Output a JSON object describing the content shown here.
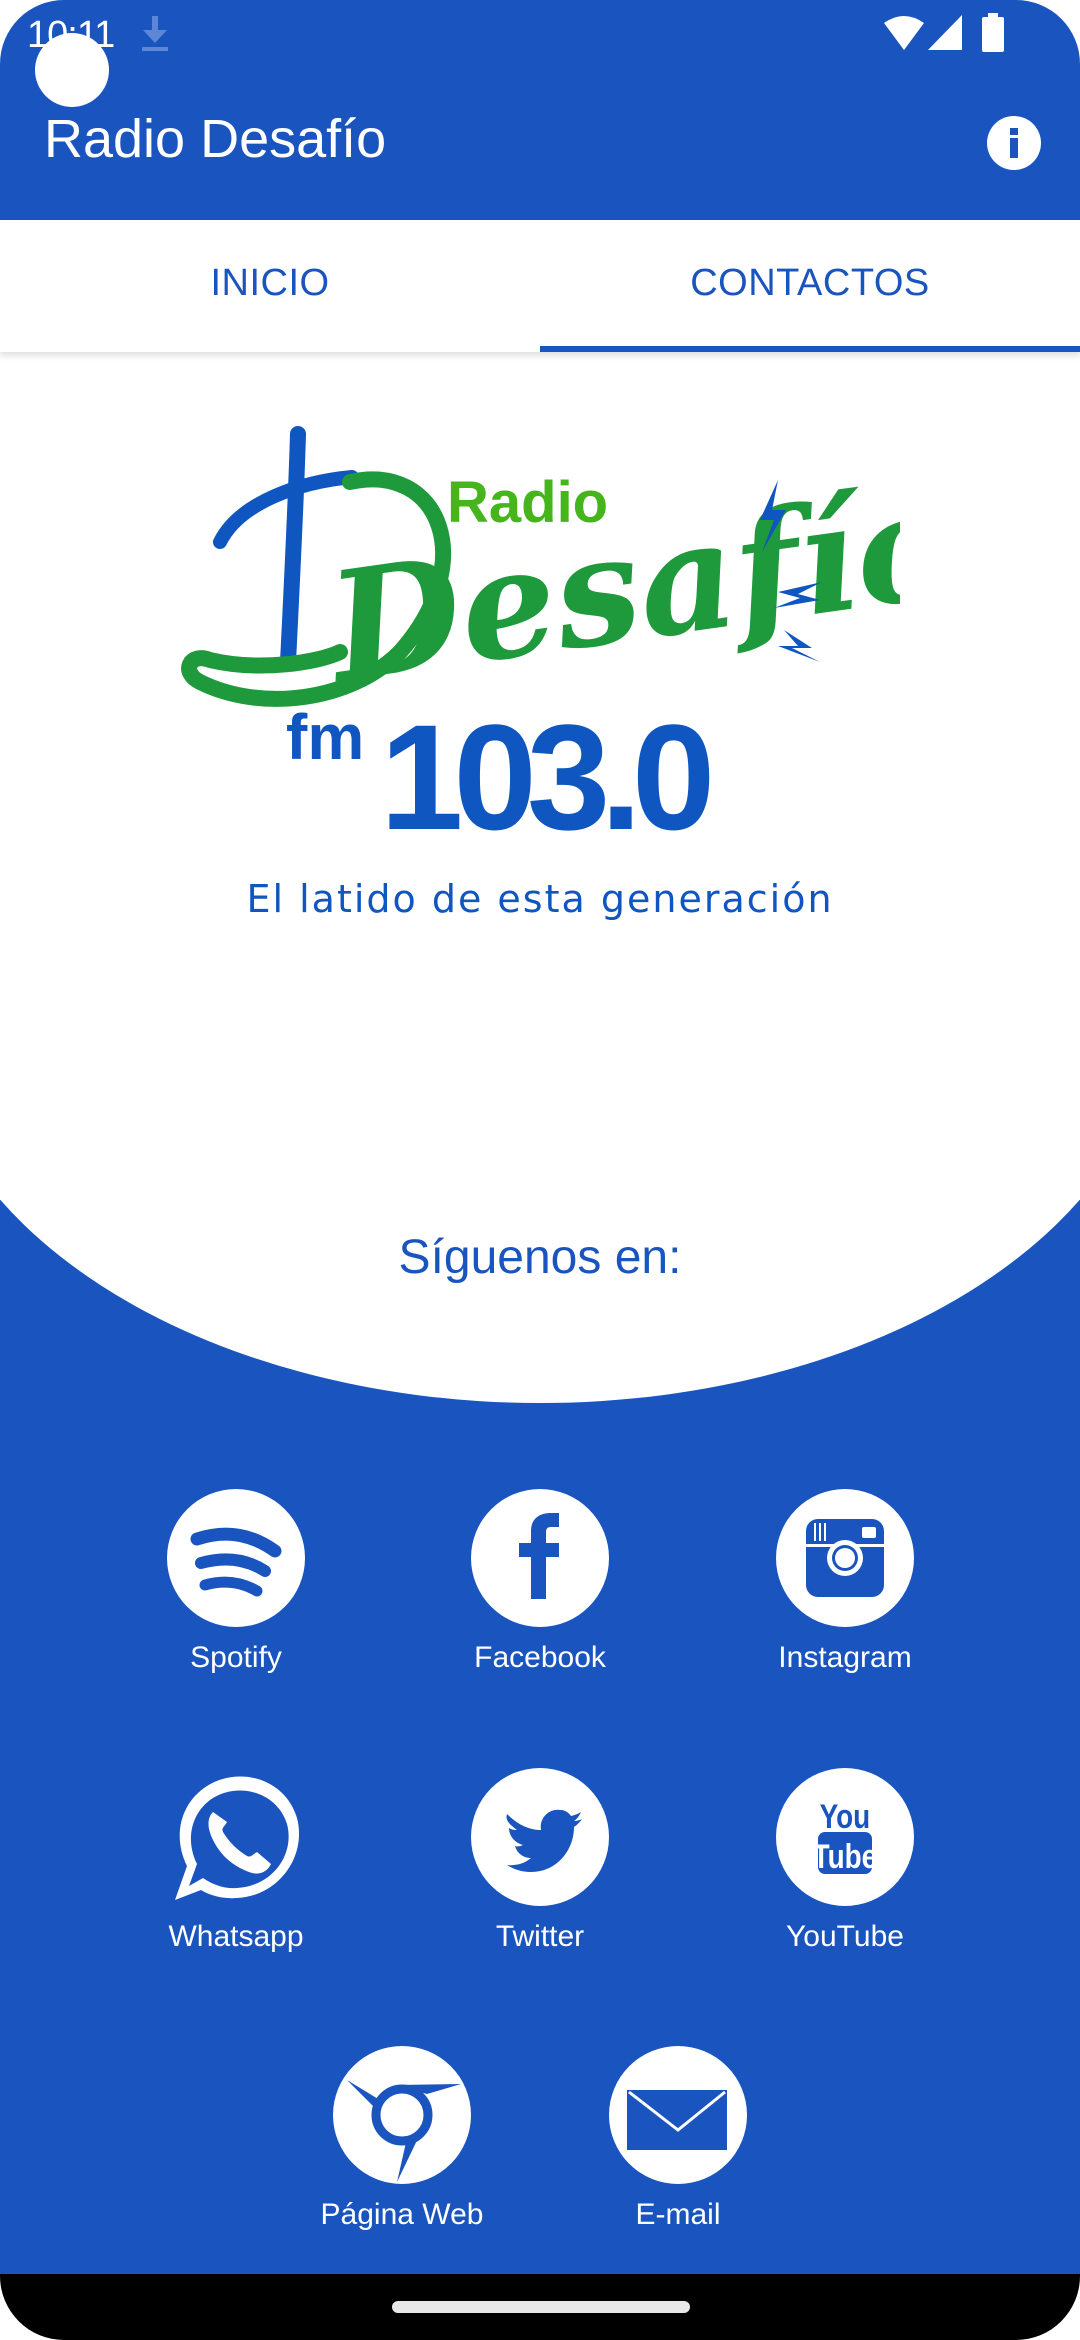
{
  "status_bar": {
    "time": "10:11",
    "icons": [
      "download-icon",
      "wifi-icon",
      "signal-icon",
      "battery-icon"
    ]
  },
  "app_bar": {
    "title": "Radio Desafío",
    "info_icon": "info-icon"
  },
  "tabs": [
    {
      "label": "INICIO",
      "active": false
    },
    {
      "label": "CONTACTOS",
      "active": true
    }
  ],
  "logo": {
    "top_word": "Radio",
    "script_word": "Desafío",
    "band": "fm",
    "frequency": "103.0",
    "slogan": "El latido de esta generación",
    "colors": {
      "blue": "#0f56c0",
      "green": "#1e9a3c",
      "light_green": "#45b51b"
    }
  },
  "follow": {
    "title": "Síguenos en:"
  },
  "social_links": [
    {
      "label": "Spotify",
      "icon": "spotify-icon"
    },
    {
      "label": "Facebook",
      "icon": "facebook-icon"
    },
    {
      "label": "Instagram",
      "icon": "instagram-icon"
    },
    {
      "label": "Whatsapp",
      "icon": "whatsapp-icon"
    },
    {
      "label": "Twitter",
      "icon": "twitter-icon"
    },
    {
      "label": "YouTube",
      "icon": "youtube-icon"
    },
    {
      "label": "Página Web",
      "icon": "web-icon"
    },
    {
      "label": "E-mail",
      "icon": "email-icon"
    }
  ],
  "theme": {
    "primary": "#1a55bf",
    "on_primary": "#ffffff",
    "nav_bar": "#000000"
  }
}
